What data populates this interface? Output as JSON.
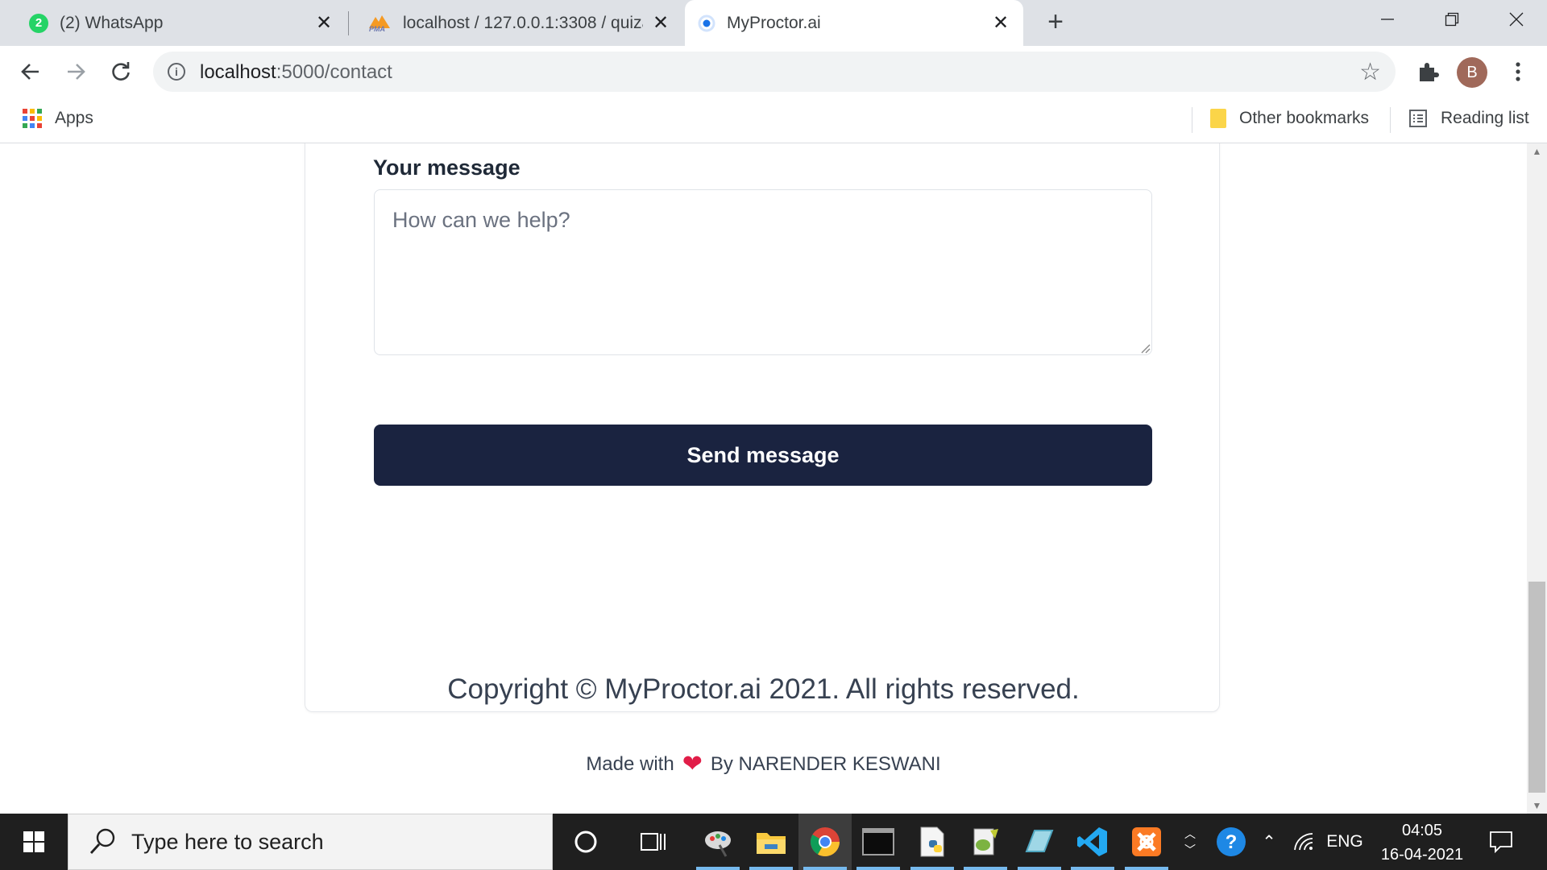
{
  "browser": {
    "tabs": [
      {
        "title": "(2) WhatsApp",
        "badge": "2",
        "icon": "whatsapp-icon",
        "active": false
      },
      {
        "title": "localhost / 127.0.0.1:3308 / quizapp",
        "icon_text": "PMA",
        "icon": "phpmyadmin-icon",
        "active": false
      },
      {
        "title": "MyProctor.ai",
        "icon": "chrome-loading-icon",
        "active": true
      }
    ],
    "url_host": "localhost",
    "url_path": ":5000/contact",
    "avatar_letter": "B",
    "bookmarks": {
      "apps": "Apps",
      "other": "Other bookmarks",
      "reading": "Reading list"
    }
  },
  "page": {
    "message_label": "Your message",
    "message_placeholder": "How can we help?",
    "send_button": "Send message",
    "copyright": "Copyright © MyProctor.ai 2021. All rights reserved.",
    "made_with": "Made with",
    "made_by": "By NARENDER KESWANI"
  },
  "taskbar": {
    "search_placeholder": "Type here to search",
    "language": "ENG",
    "time": "04:05",
    "date": "16-04-2021"
  },
  "colors": {
    "button_bg": "#1a2340",
    "tab_strip": "#dee1e6",
    "taskbar_bg": "#1f1f1f",
    "heart": "#e11d48"
  }
}
